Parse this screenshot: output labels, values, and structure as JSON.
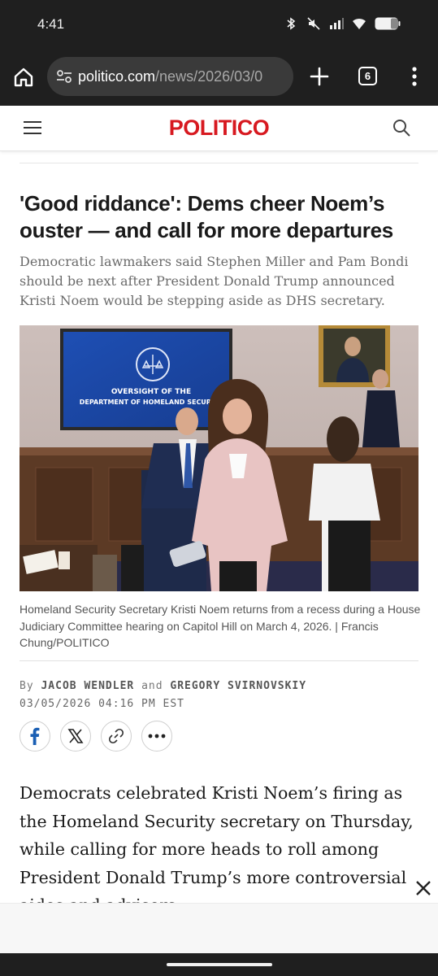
{
  "status": {
    "time": "4:41",
    "icons": [
      "bluetooth-icon",
      "mute-icon",
      "signal-icon",
      "wifi-icon",
      "battery-icon"
    ]
  },
  "browser": {
    "url_domain": "politico.com",
    "url_path": "/news/2026/03/0",
    "tab_count": "6",
    "icons": [
      "home-icon",
      "tune-icon",
      "plus-icon",
      "more-vert-icon"
    ]
  },
  "site": {
    "logo": "POLITICO",
    "brand_color": "#d71920"
  },
  "article": {
    "headline": "'Good riddance': Dems cheer Noem’s ouster — and call for more departures",
    "dek": "Democratic lawmakers said Stephen Miller and Pam Bondi should be next after President Donald Trump announced Kristi Noem would be stepping aside as DHS secretary.",
    "photo": {
      "screen_line1": "OVERSIGHT OF THE",
      "screen_line2": "DEPARTMENT OF HOMELAND SECURITY"
    },
    "caption": "Homeland Security Secretary Kristi Noem returns from a recess during a House Judiciary Committee hearing on Capitol Hill on March 4, 2026. | Francis Chung/POLITICO",
    "byline_prefix": "By",
    "author1": "JACOB WENDLER",
    "byline_and": "and",
    "author2": "GREGORY SVIRNOVSKIY",
    "dateline": "03/05/2026 04:16 PM EST",
    "share": [
      "facebook-icon",
      "x-icon",
      "link-icon",
      "more-icon"
    ],
    "body": "Democrats celebrated Kristi Noem’s firing as the Homeland Security secretary on Thursday, while calling for more heads to roll among President Donald Trump’s more controversial aides and advisers."
  }
}
